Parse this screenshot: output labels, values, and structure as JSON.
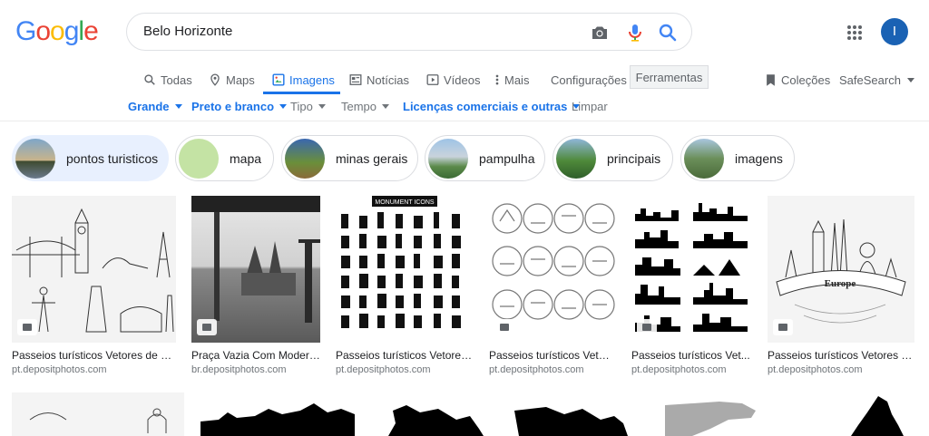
{
  "header": {
    "logo_letters": [
      "G",
      "o",
      "o",
      "g",
      "l",
      "e"
    ],
    "logo_colors": [
      "#4285f4",
      "#ea4335",
      "#fbbc05",
      "#4285f4",
      "#34a853",
      "#ea4335"
    ],
    "query": "Belo Horizonte",
    "avatar_letter": "I",
    "avatar_color": "#1a62b4"
  },
  "tabs": {
    "todas": "Todas",
    "maps": "Maps",
    "imagens": "Imagens",
    "noticias": "Notícias",
    "videos": "Vídeos",
    "mais": "Mais",
    "configuracoes": "Configurações",
    "ferramentas": "Ferramentas",
    "colecoes": "Coleções",
    "safesearch": "SafeSearch"
  },
  "filters": {
    "grande": "Grande",
    "preto_branco": "Preto e branco",
    "tipo": "Tipo",
    "tempo": "Tempo",
    "licencas": "Licenças comerciais e outras",
    "limpar": "Limpar"
  },
  "chips": [
    {
      "label": "pontos turisticos",
      "selected": true
    },
    {
      "label": "mapa",
      "selected": false
    },
    {
      "label": "minas gerais",
      "selected": false
    },
    {
      "label": "pampulha",
      "selected": false
    },
    {
      "label": "principais",
      "selected": false
    },
    {
      "label": "imagens",
      "selected": false
    }
  ],
  "results": [
    {
      "title": "Passeios turísticos Vetores de St...",
      "source": "pt.depositphotos.com"
    },
    {
      "title": "Praça Vazia Com Modern...",
      "source": "br.depositphotos.com"
    },
    {
      "title": "Passeios turísticos Vetores...",
      "source": "pt.depositphotos.com"
    },
    {
      "title": "Passeios turísticos Vetor...",
      "source": "pt.depositphotos.com"
    },
    {
      "title": "Passeios turísticos Vet...",
      "source": "pt.depositphotos.com"
    },
    {
      "title": "Passeios turísticos Vetores d...",
      "source": "pt.depositphotos.com"
    }
  ],
  "thumb_overlays": {
    "monument_icons": "MONUMENT ICONS",
    "europe_banner": "Europe"
  },
  "colors": {
    "accent": "#1a73e8",
    "chip_selected": "#e8f0fe"
  }
}
